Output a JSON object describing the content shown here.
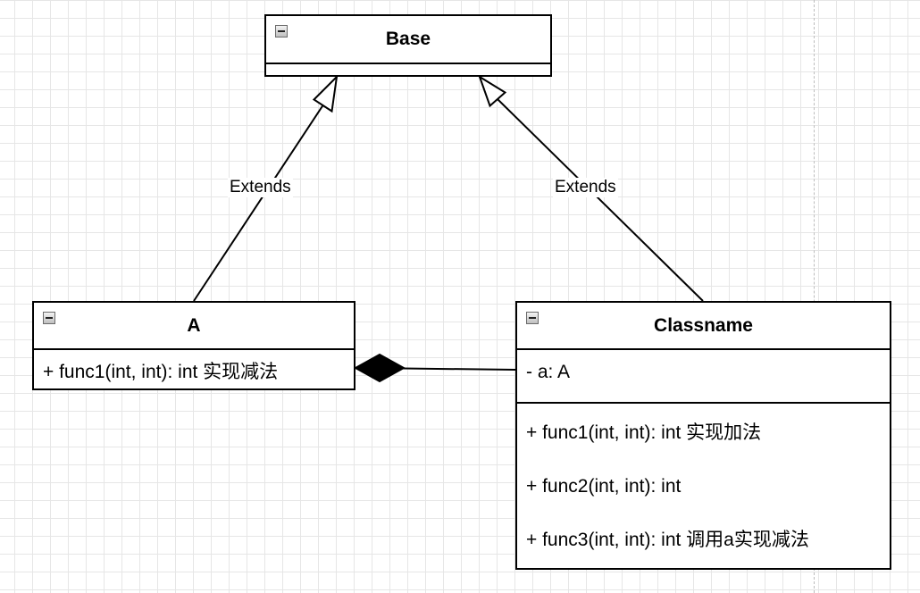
{
  "diagram": {
    "classes": {
      "base": {
        "name": "Base",
        "attributes": [],
        "methods": []
      },
      "a": {
        "name": "A",
        "methods": [
          "+ func1(int, int): int 实现减法"
        ]
      },
      "classname": {
        "name": "Classname",
        "attributes": [
          "- a: A"
        ],
        "methods": [
          "+ func1(int, int): int 实现加法",
          "+ func2(int, int): int",
          "+ func3(int, int): int 调用a实现减法"
        ]
      }
    },
    "relations": {
      "a_extends_base": {
        "label": "Extends",
        "type": "generalization"
      },
      "classname_extends_base": {
        "label": "Extends",
        "type": "generalization"
      },
      "classname_composes_a": {
        "type": "composition"
      }
    }
  }
}
